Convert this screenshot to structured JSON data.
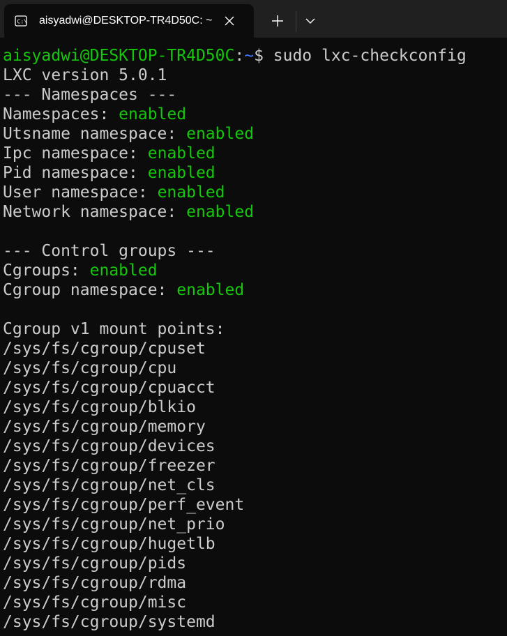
{
  "tab": {
    "title": "aisyadwi@DESKTOP-TR4D50C: ~",
    "icon": "terminal-icon"
  },
  "toolbar": {
    "close_icon": "close-icon",
    "new_tab_icon": "plus-icon",
    "dropdown_icon": "chevron-down-icon"
  },
  "colors": {
    "background": "#0c0c0c",
    "tabbar": "#202020",
    "text": "#cccccc",
    "green": "#16c60c",
    "blue": "#3b78ff"
  },
  "prompt": {
    "user_host": "aisyadwi@DESKTOP-TR4D50C",
    "colon": ":",
    "path": "~",
    "dollar": "$ ",
    "command": "sudo lxc-checkconfig"
  },
  "output": {
    "version": "LXC version 5.0.1",
    "ns_header": "--- Namespaces ---",
    "namespaces": [
      {
        "label": "Namespaces: ",
        "status": "enabled"
      },
      {
        "label": "Utsname namespace: ",
        "status": "enabled"
      },
      {
        "label": "Ipc namespace: ",
        "status": "enabled"
      },
      {
        "label": "Pid namespace: ",
        "status": "enabled"
      },
      {
        "label": "User namespace: ",
        "status": "enabled"
      },
      {
        "label": "Network namespace: ",
        "status": "enabled"
      }
    ],
    "cg_header": "--- Control groups ---",
    "cgroups": [
      {
        "label": "Cgroups: ",
        "status": "enabled"
      },
      {
        "label": "Cgroup namespace: ",
        "status": "enabled"
      }
    ],
    "mount_header": "Cgroup v1 mount points:",
    "mounts": [
      "/sys/fs/cgroup/cpuset",
      "/sys/fs/cgroup/cpu",
      "/sys/fs/cgroup/cpuacct",
      "/sys/fs/cgroup/blkio",
      "/sys/fs/cgroup/memory",
      "/sys/fs/cgroup/devices",
      "/sys/fs/cgroup/freezer",
      "/sys/fs/cgroup/net_cls",
      "/sys/fs/cgroup/perf_event",
      "/sys/fs/cgroup/net_prio",
      "/sys/fs/cgroup/hugetlb",
      "/sys/fs/cgroup/pids",
      "/sys/fs/cgroup/rdma",
      "/sys/fs/cgroup/misc",
      "/sys/fs/cgroup/systemd"
    ]
  }
}
